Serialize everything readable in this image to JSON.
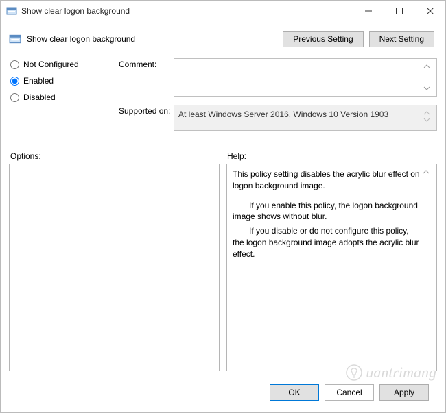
{
  "window": {
    "title": "Show clear logon background"
  },
  "header": {
    "title": "Show clear logon background",
    "prev_button": "Previous Setting",
    "next_button": "Next Setting"
  },
  "radios": {
    "not_configured": "Not Configured",
    "enabled": "Enabled",
    "disabled": "Disabled",
    "selected": "enabled"
  },
  "comment": {
    "label": "Comment:",
    "value": ""
  },
  "supported": {
    "label": "Supported on:",
    "value": "At least Windows Server 2016, Windows 10 Version 1903"
  },
  "sections": {
    "options_label": "Options:",
    "help_label": "Help:"
  },
  "help": {
    "p1": "This policy setting disables the acrylic blur effect on logon background image.",
    "p2": "If you enable this policy, the logon background image shows without blur.",
    "p3": "If you disable or do not configure this policy, the logon background image adopts the acrylic blur effect."
  },
  "footer": {
    "ok": "OK",
    "cancel": "Cancel",
    "apply": "Apply"
  },
  "watermark": "uantrimang"
}
